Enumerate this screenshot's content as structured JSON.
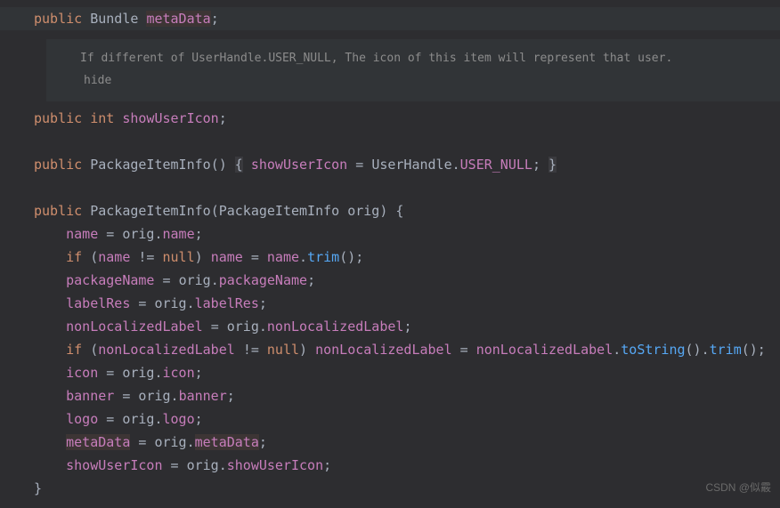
{
  "code": {
    "line1_public": "public",
    "line1_type": "Bundle",
    "line1_field": "metaData",
    "comment_text": "If different of UserHandle.USER_NULL, The icon of this item will represent that user.",
    "hide_text": "hide",
    "line3_public": "public",
    "line3_type": "int",
    "line3_field": "showUserIcon",
    "ctor1_public": "public",
    "ctor1_name": "PackageItemInfo",
    "ctor1_field": "showUserIcon",
    "ctor1_class": "UserHandle",
    "ctor1_const": "USER_NULL",
    "ctor2_public": "public",
    "ctor2_name": "PackageItemInfo",
    "ctor2_ptype": "PackageItemInfo",
    "ctor2_pname": "orig",
    "l_name": "name",
    "l_if": "if",
    "l_null": "null",
    "l_trim": "trim",
    "l_packageName": "packageName",
    "l_labelRes": "labelRes",
    "l_nonLocalizedLabel": "nonLocalizedLabel",
    "l_toString": "toString",
    "l_icon": "icon",
    "l_banner": "banner",
    "l_logo": "logo",
    "l_metaData": "metaData",
    "l_showUserIcon": "showUserIcon",
    "l_orig": "orig"
  },
  "watermark": "CSDN @似霰"
}
